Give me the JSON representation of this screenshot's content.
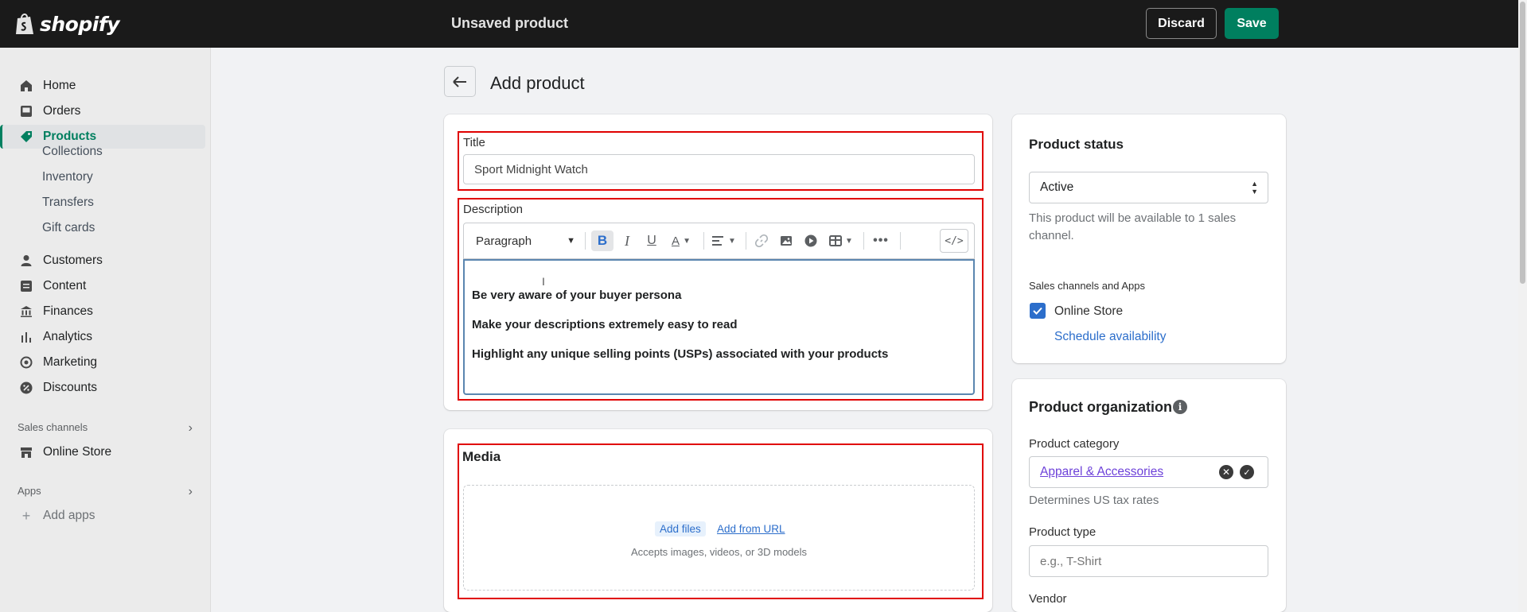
{
  "topbar": {
    "brand": "shopify",
    "title": "Unsaved product",
    "discard_label": "Discard",
    "save_label": "Save"
  },
  "sidebar": {
    "items": [
      {
        "label": "Home",
        "icon": "home-icon"
      },
      {
        "label": "Orders",
        "icon": "orders-icon"
      },
      {
        "label": "Products",
        "icon": "tag-icon",
        "active": true
      },
      {
        "label": "Customers",
        "icon": "person-icon"
      },
      {
        "label": "Content",
        "icon": "content-icon"
      },
      {
        "label": "Finances",
        "icon": "bank-icon"
      },
      {
        "label": "Analytics",
        "icon": "bar-chart-icon"
      },
      {
        "label": "Marketing",
        "icon": "target-icon"
      },
      {
        "label": "Discounts",
        "icon": "discount-icon"
      }
    ],
    "product_sub_items": [
      "Collections",
      "Inventory",
      "Transfers",
      "Gift cards"
    ],
    "sales_channels_header": "Sales channels",
    "online_store_label": "Online Store",
    "apps_header": "Apps",
    "add_apps_label": "Add apps"
  },
  "page": {
    "title": "Add product"
  },
  "product_form": {
    "title_label": "Title",
    "title_value": "Sport Midnight Watch",
    "description_label": "Description",
    "format_select": "Paragraph",
    "description_lines": [
      "Be very aware of your buyer persona",
      "Make your descriptions extremely easy to read",
      "Highlight any unique selling points (USPs) associated with your products"
    ]
  },
  "media": {
    "title": "Media",
    "add_files_label": "Add files",
    "add_url_label": "Add from URL",
    "hint": "Accepts images, videos, or 3D models"
  },
  "status_card": {
    "title": "Product status",
    "selected": "Active",
    "help": "This product will be available to 1 sales channel.",
    "channels_header": "Sales channels and Apps",
    "online_store_label": "Online Store",
    "schedule_label": "Schedule availability"
  },
  "organization_card": {
    "title": "Product organization",
    "category_label": "Product category",
    "category_value": "Apparel & Accessories",
    "category_help": "Determines US tax rates",
    "type_label": "Product type",
    "type_placeholder": "e.g., T-Shirt",
    "vendor_label": "Vendor"
  },
  "colors": {
    "accent": "#008060",
    "topbar": "#1a1a1a",
    "highlight_border": "#e00000",
    "link": "#2c6ecb"
  }
}
